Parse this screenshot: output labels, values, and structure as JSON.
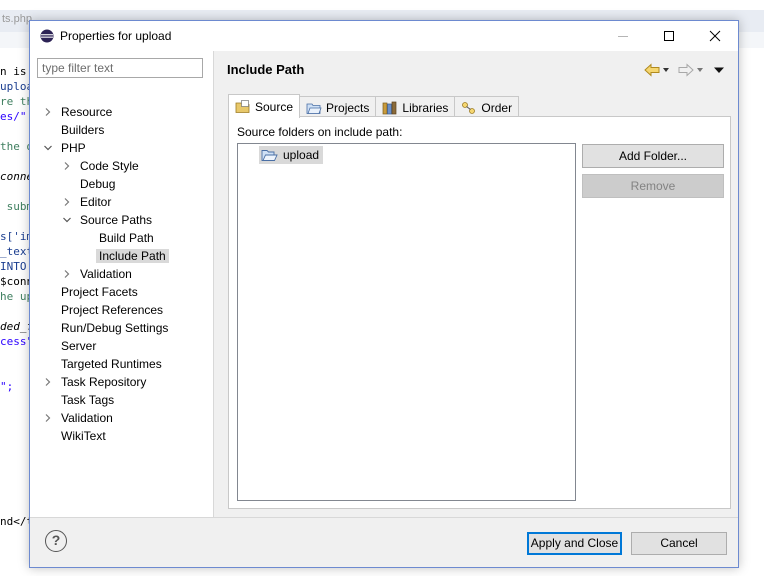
{
  "background_editor": {
    "tab_label": "ts.php",
    "code_lines": [
      {
        "text": "n is ",
        "cls": "c-k"
      },
      {
        "text": "uploa",
        "cls": "c-b"
      },
      {
        "text": "re th",
        "cls": "c-g"
      },
      {
        "text": "es/\".",
        "cls": "c-s"
      },
      {
        "text": "",
        "cls": "c-k"
      },
      {
        "text": "the d",
        "cls": "c-g"
      },
      {
        "text": "",
        "cls": "c-k"
      },
      {
        "text": "conne",
        "cls": "c-i"
      },
      {
        "text": "",
        "cls": "c-k"
      },
      {
        "text": " subm",
        "cls": "c-g"
      },
      {
        "text": "",
        "cls": "c-k"
      },
      {
        "text": "s['im",
        "cls": "c-b"
      },
      {
        "text": "_text",
        "cls": "c-b"
      },
      {
        "text": "INTO ",
        "cls": "c-b"
      },
      {
        "text": "$conn",
        "cls": "c-k"
      },
      {
        "text": "he up",
        "cls": "c-g"
      },
      {
        "text": "",
        "cls": "c-k"
      },
      {
        "text": "ded_f",
        "cls": "c-i"
      },
      {
        "text": "cess\"",
        "cls": "c-s"
      },
      {
        "text": "",
        "cls": "c-k"
      },
      {
        "text": "",
        "cls": "c-k"
      },
      {
        "text": "\";",
        "cls": "c-s"
      },
      {
        "text": "",
        "cls": "c-k"
      },
      {
        "text": "",
        "cls": "c-k"
      },
      {
        "text": "",
        "cls": "c-k"
      },
      {
        "text": "",
        "cls": "c-k"
      },
      {
        "text": "",
        "cls": "c-k"
      },
      {
        "text": "",
        "cls": "c-k"
      },
      {
        "text": "",
        "cls": "c-k"
      },
      {
        "text": "",
        "cls": "c-k"
      },
      {
        "text": "nd</t",
        "cls": "c-k"
      }
    ]
  },
  "dialog": {
    "title": "Properties for upload",
    "title_buttons": [
      "minimize",
      "maximize",
      "close"
    ]
  },
  "filter": {
    "placeholder": "type filter text",
    "value": ""
  },
  "tree": [
    {
      "label": "Resource",
      "level": 0,
      "expander": "collapsed"
    },
    {
      "label": "Builders",
      "level": 0,
      "expander": "none"
    },
    {
      "label": "PHP",
      "level": 0,
      "expander": "expanded"
    },
    {
      "label": "Code Style",
      "level": 1,
      "expander": "collapsed"
    },
    {
      "label": "Debug",
      "level": 1,
      "expander": "none"
    },
    {
      "label": "Editor",
      "level": 1,
      "expander": "collapsed"
    },
    {
      "label": "Source Paths",
      "level": 1,
      "expander": "expanded"
    },
    {
      "label": "Build Path",
      "level": 2,
      "expander": "none"
    },
    {
      "label": "Include Path",
      "level": 2,
      "expander": "none",
      "selected": true
    },
    {
      "label": "Validation",
      "level": 1,
      "expander": "collapsed"
    },
    {
      "label": "Project Facets",
      "level": 0,
      "expander": "none"
    },
    {
      "label": "Project References",
      "level": 0,
      "expander": "none"
    },
    {
      "label": "Run/Debug Settings",
      "level": 0,
      "expander": "none"
    },
    {
      "label": "Server",
      "level": 0,
      "expander": "none"
    },
    {
      "label": "Targeted Runtimes",
      "level": 0,
      "expander": "none"
    },
    {
      "label": "Task Repository",
      "level": 0,
      "expander": "collapsed"
    },
    {
      "label": "Task Tags",
      "level": 0,
      "expander": "none"
    },
    {
      "label": "Validation",
      "level": 0,
      "expander": "collapsed"
    },
    {
      "label": "WikiText",
      "level": 0,
      "expander": "none"
    }
  ],
  "page": {
    "title": "Include Path",
    "nav_icons": [
      "back-arrow-icon",
      "back-dropdown-icon",
      "forward-arrow-icon",
      "forward-dropdown-icon",
      "view-menu-icon"
    ],
    "tabs": [
      {
        "label": "Source",
        "icon": "source-icon",
        "active": true
      },
      {
        "label": "Projects",
        "icon": "projects-icon",
        "active": false
      },
      {
        "label": "Libraries",
        "icon": "libraries-icon",
        "active": false
      },
      {
        "label": "Order",
        "icon": "order-icon",
        "active": false
      }
    ],
    "source_label": "Source folders on include path:",
    "folders": [
      {
        "name": "upload",
        "icon": "open-folder-icon"
      }
    ],
    "add_folder_label": "Add Folder...",
    "remove_label": "Remove"
  },
  "footer": {
    "help_icon": "help-icon",
    "help_glyph": "?",
    "apply_label": "Apply and Close",
    "cancel_label": "Cancel"
  },
  "colors": {
    "accent": "#0078d7",
    "selection": "#d9d9d9",
    "dialog_bg": "#f0f0f0"
  }
}
